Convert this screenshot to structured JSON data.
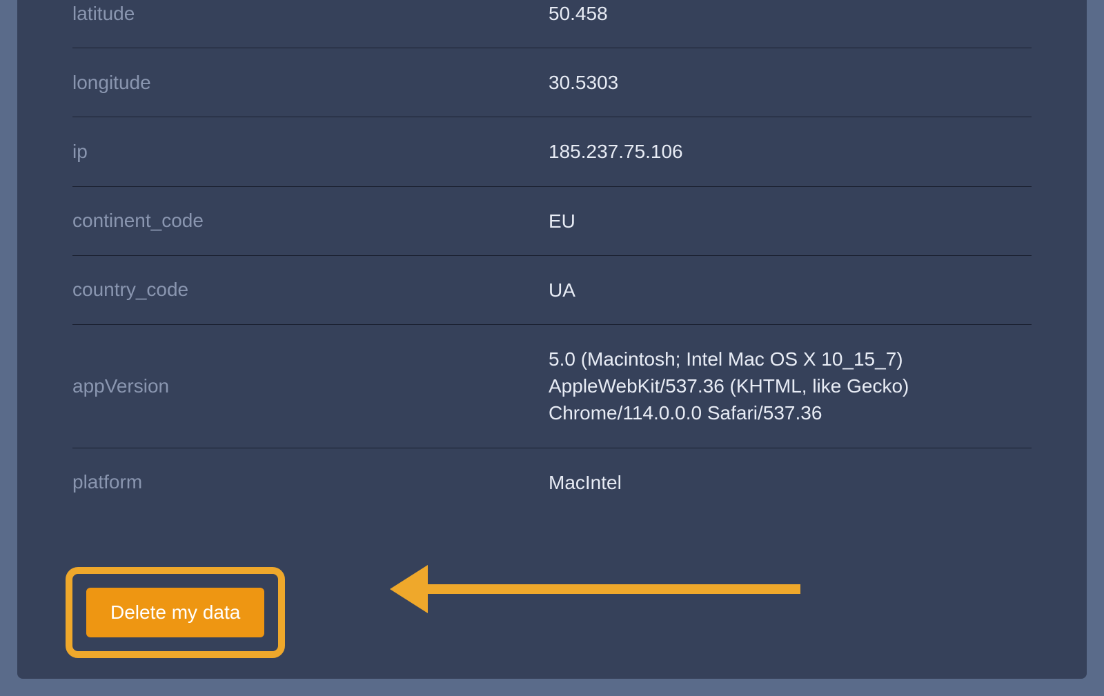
{
  "rows": [
    {
      "key": "latitude",
      "value": "50.458"
    },
    {
      "key": "longitude",
      "value": "30.5303"
    },
    {
      "key": "ip",
      "value": "185.237.75.106"
    },
    {
      "key": "continent_code",
      "value": "EU"
    },
    {
      "key": "country_code",
      "value": "UA"
    },
    {
      "key": "appVersion",
      "value": "5.0 (Macintosh; Intel Mac OS X 10_15_7) AppleWebKit/537.36 (KHTML, like Gecko) Chrome/114.0.0.0 Safari/537.36"
    },
    {
      "key": "platform",
      "value": "MacIntel"
    }
  ],
  "actions": {
    "delete_label": "Delete my data"
  }
}
